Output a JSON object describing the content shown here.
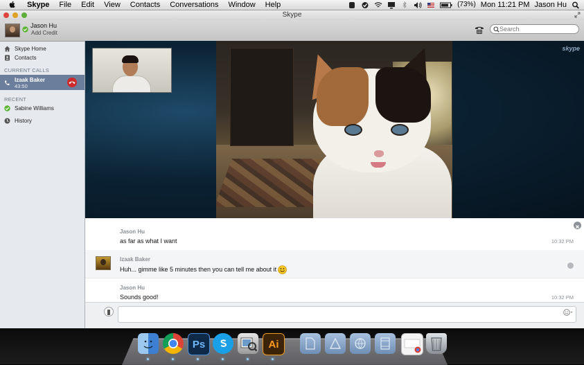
{
  "menubar": {
    "app_name": "Skype",
    "items": [
      "File",
      "Edit",
      "View",
      "Contacts",
      "Conversations",
      "Window",
      "Help"
    ],
    "battery": "(73%)",
    "clock": "Mon 11:21 PM",
    "user": "Jason Hu"
  },
  "window": {
    "title": "Skype"
  },
  "toolbar": {
    "user_name": "Jason Hu",
    "add_credit": "Add Credit",
    "search_placeholder": "Search"
  },
  "sidebar": {
    "skype_home": "Skype Home",
    "contacts": "Contacts",
    "current_calls_header": "CURRENT CALLS",
    "call": {
      "name": "Izaak Baker",
      "duration": "43:50"
    },
    "recent_header": "RECENT",
    "recent_contact": "Sabine Williams",
    "history": "History"
  },
  "video": {
    "logo": "skype"
  },
  "chat": {
    "messages": [
      {
        "author": "Jason Hu",
        "text": "as far as what I want",
        "time": "10:32 PM"
      },
      {
        "author": "Izaak Baker",
        "text": "Huh... gimme like 5 minutes then you can tell me about it",
        "time": ""
      },
      {
        "author": "Jason Hu",
        "text": "Sounds good!",
        "time": "10:32 PM"
      }
    ]
  },
  "compose": {
    "placeholder": ""
  },
  "colors": {
    "selection": "#6b7f9c",
    "hangup": "#d02b2b",
    "status_online": "#5cb531",
    "video_bg": "#0b2233"
  },
  "dock": {
    "icons": [
      "finder-icon",
      "chrome-icon",
      "photoshop-icon",
      "skype-icon",
      "preview-icon",
      "illustrator-icon",
      "documents-folder-icon",
      "applications-folder-icon",
      "downloads-folder-icon",
      "movies-folder-icon",
      "document-stack-icon",
      "trash-icon"
    ],
    "photoshop_label": "Ps",
    "illustrator_label": "Ai"
  }
}
